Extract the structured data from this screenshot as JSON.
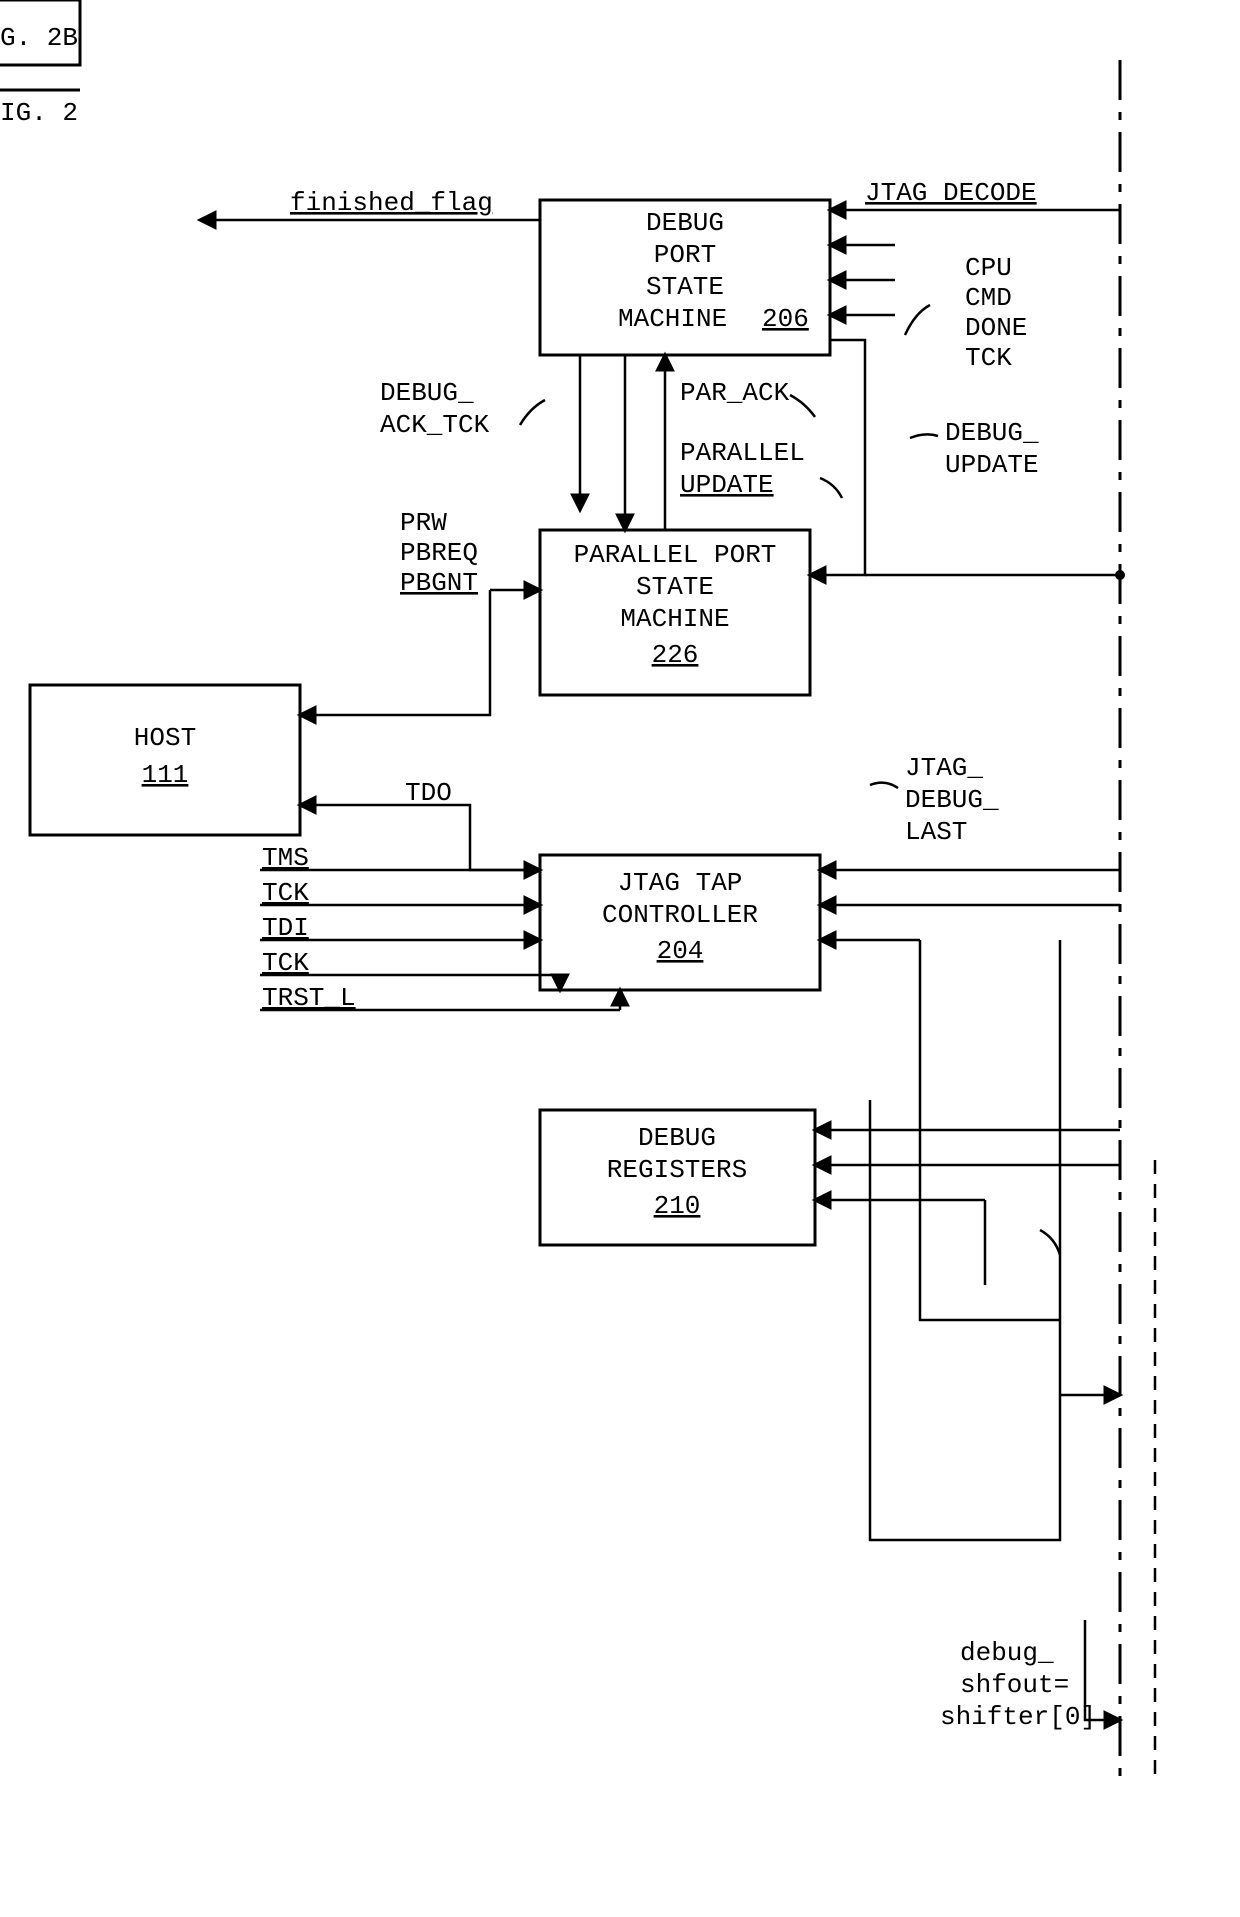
{
  "figTabBox": "G. 2B",
  "figCaption": "IG. 2",
  "blocks": {
    "host": {
      "title": "HOST",
      "ref": "111"
    },
    "dpsm": {
      "l1": "DEBUG",
      "l2": "PORT",
      "l3": "STATE",
      "l4": "MACHINE",
      "ref": "206"
    },
    "ppsm": {
      "l1": "PARALLEL PORT",
      "l2": "STATE",
      "l3": "MACHINE",
      "ref": "226"
    },
    "jtag": {
      "l1": "JTAG TAP",
      "l2": "CONTROLLER",
      "ref": "204"
    },
    "dreg": {
      "l1": "DEBUG",
      "l2": "REGISTERS",
      "ref": "210"
    }
  },
  "signals": {
    "finished": "finished_flag",
    "jtag_decode": "JTAG DECODE",
    "cpu": "CPU",
    "cmd": "CMD",
    "done": "DONE",
    "tck_r": "TCK",
    "debug_ack": "DEBUG_",
    "ack_tck": "ACK_TCK",
    "par_ack": "PAR_ACK",
    "parallel": "PARALLEL",
    "update": "UPDATE",
    "debug_update1": "DEBUG_",
    "debug_update2": "UPDATE",
    "prw": "PRW",
    "pbreq": "PBREQ",
    "pbgnt": "PBGNT",
    "tdo": "TDO",
    "tms": "TMS",
    "tck": "TCK",
    "tdi": "TDI",
    "tck2": "TCK",
    "trst": "TRST_L",
    "jtag_dbg1": "JTAG_",
    "jtag_dbg2": "DEBUG_",
    "jtag_dbg3": "LAST",
    "shf1": "debug_",
    "shf2": "shfout=",
    "shf3": "shifter[0]"
  }
}
